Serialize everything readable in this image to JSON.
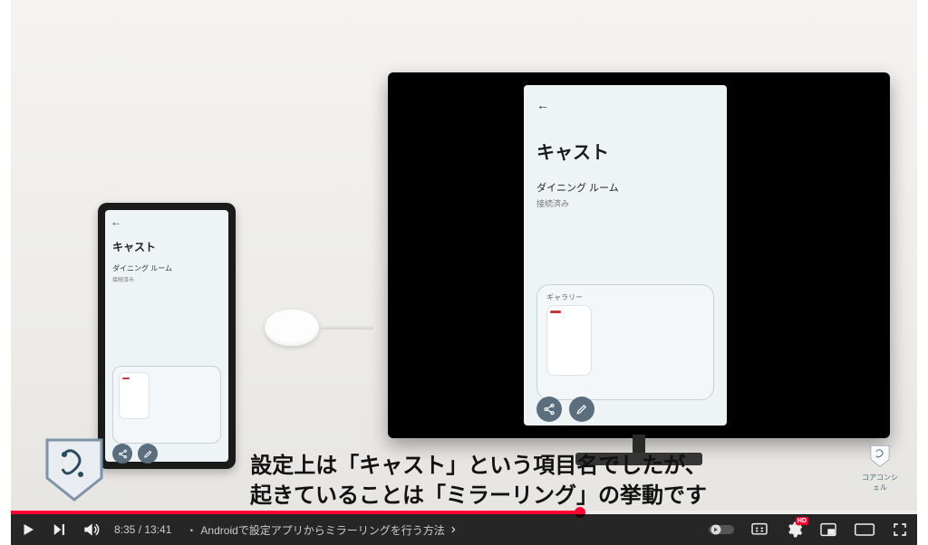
{
  "phone": {
    "title": "キャスト",
    "device": "ダイニング ルーム",
    "status": "接続済み"
  },
  "tv": {
    "title": "キャスト",
    "device": "ダイニング ルーム",
    "status": "接続済み",
    "card_label": "ギャラリー"
  },
  "caption": {
    "line1": "設定上は「キャスト」という項目名でしたが、",
    "line2": "起きていることは「ミラーリング」の挙動です"
  },
  "brand_right": "コアコンシェル",
  "player": {
    "current_time": "8:35",
    "duration": "13:41",
    "chapter_prefix": "・",
    "chapter": "Androidで設定アプリからミラーリングを行う方法",
    "hd_label": "HD",
    "progress_pct": 62.8
  }
}
